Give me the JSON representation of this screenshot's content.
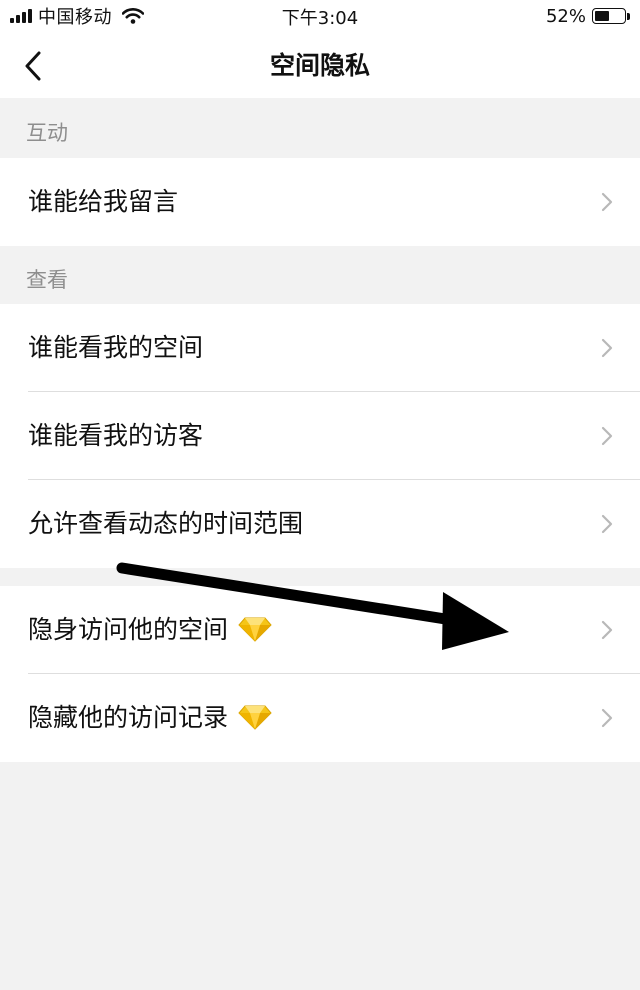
{
  "status_bar": {
    "carrier": "中国移动",
    "time": "下午3:04",
    "battery_percent": "52%",
    "battery_level": 0.52
  },
  "nav": {
    "title": "空间隐私",
    "back_icon": "chevron-left-icon"
  },
  "sections": [
    {
      "header": "互动",
      "items": [
        {
          "label": "谁能给我留言"
        }
      ]
    },
    {
      "header": "查看",
      "items": [
        {
          "label": "谁能看我的空间"
        },
        {
          "label": "谁能看我的访客"
        },
        {
          "label": "允许查看动态的时间范围"
        }
      ]
    },
    {
      "header": "",
      "items": [
        {
          "label": "隐身访问他的空间",
          "badge_icon": "diamond-icon"
        },
        {
          "label": "隐藏他的访问记录",
          "badge_icon": "diamond-icon"
        }
      ]
    }
  ],
  "colors": {
    "background": "#f2f2f2",
    "row_background": "#ffffff",
    "section_header_text": "#8e8e8e",
    "chevron": "#b8b8b8",
    "diamond": "#f5c518",
    "annotation_arrow": "#000000"
  }
}
